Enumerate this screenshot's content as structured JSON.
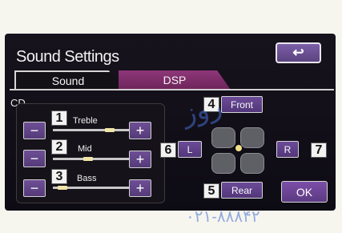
{
  "header": {
    "title": "Sound Settings",
    "back_icon": "↩"
  },
  "tabs": [
    {
      "label": "Sound",
      "active": true
    },
    {
      "label": "DSP",
      "active": false
    }
  ],
  "source_label": "CD",
  "sliders": [
    {
      "number": "1",
      "name": "Treble",
      "minus": "−",
      "plus": "+"
    },
    {
      "number": "2",
      "name": "Mid",
      "minus": "−",
      "plus": "+"
    },
    {
      "number": "3",
      "name": "Bass",
      "minus": "−",
      "plus": "+"
    }
  ],
  "balance": {
    "front": {
      "number": "4",
      "label": "Front"
    },
    "rear": {
      "number": "5",
      "label": "Rear"
    },
    "left": {
      "number": "6",
      "label": "L"
    },
    "right": {
      "number": "7",
      "label": "R"
    }
  },
  "ok_label": "OK",
  "watermark": {
    "text": "روز",
    "phone": "۰۲۱-۸۸۸۴۲"
  },
  "colors": {
    "accent": "#6e4f96",
    "dsp_tab": "#8e3779",
    "screen_bg": "#17131d"
  }
}
